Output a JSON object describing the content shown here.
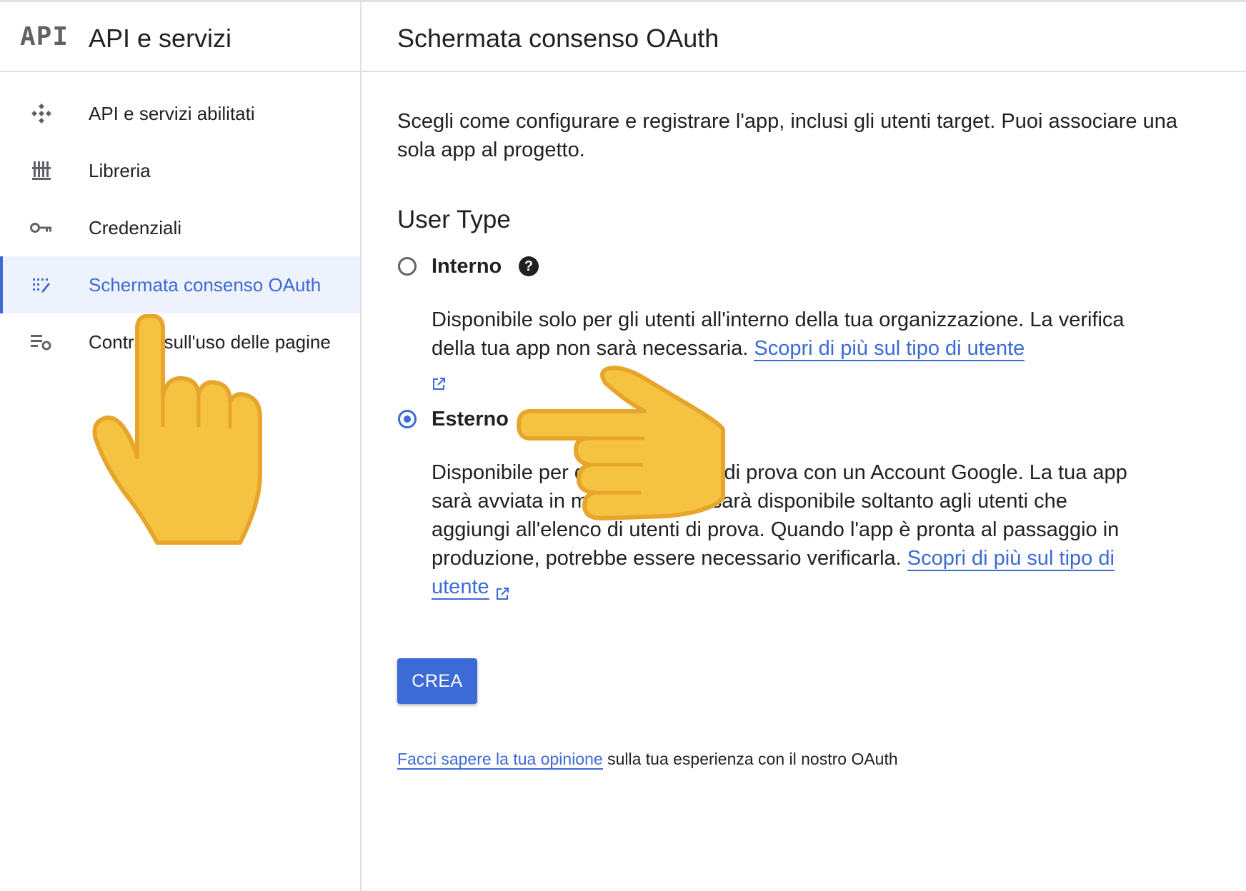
{
  "sidebar": {
    "logo": "API",
    "title": "API e servizi",
    "items": [
      {
        "label": "API e servizi abilitati",
        "icon": "api-diamond-icon"
      },
      {
        "label": "Libreria",
        "icon": "library-icon"
      },
      {
        "label": "Credenziali",
        "icon": "key-icon"
      },
      {
        "label": "Schermata consenso OAuth",
        "icon": "oauth-consent-icon",
        "active": true
      },
      {
        "label": "Contratti sull'uso delle pagine",
        "icon": "page-usage-icon"
      }
    ]
  },
  "main": {
    "title": "Schermata consenso OAuth",
    "intro": "Scegli come configurare e registrare l'app, inclusi gli utenti target. Puoi associare una sola app al progetto.",
    "user_type_title": "User Type",
    "options": {
      "internal": {
        "label": "Interno",
        "description": "Disponibile solo per gli utenti all'interno della tua organizzazione. La verifica della tua app non sarà necessaria.",
        "link": "Scopri di più sul tipo di utente",
        "selected": false
      },
      "external": {
        "label": "Esterno",
        "description": "Disponibile per qualsiasi utente di prova con un Account Google. La tua app sarà avviata in modalità test e sarà disponibile soltanto agli utenti che aggiungi all'elenco di utenti di prova. Quando l'app è pronta al passaggio in produzione, potrebbe essere necessario verificarla.",
        "link": "Scopri di più sul tipo di utente",
        "selected": true
      }
    },
    "create_button": "CREA",
    "feedback_link": "Facci sapere la tua opinione",
    "feedback_text": " sulla tua esperienza con il nostro OAuth"
  },
  "colors": {
    "accent": "#3c6ad6",
    "active_bg": "#eef2fc",
    "hand": "#f5c242"
  }
}
